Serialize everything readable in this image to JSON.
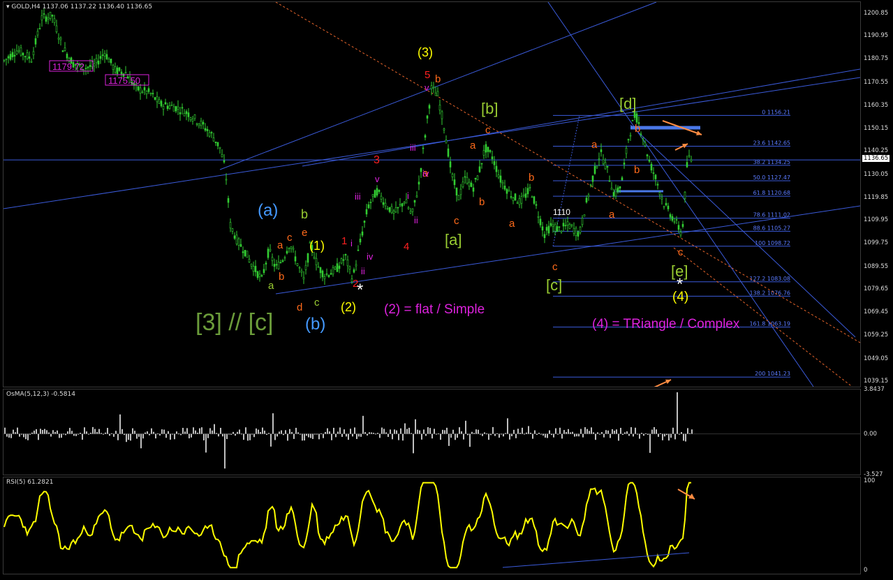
{
  "window": {
    "symbol_title": "GOLD,H4",
    "ohlc": "1137.06 1137.22 1136.40 1136.65",
    "current_price": "1136.65"
  },
  "chart_data": [
    {
      "type": "candlestick",
      "title": "GOLD,H4",
      "ylim": [
        1037,
        1206
      ],
      "y_ticks": [
        "1200.85",
        "1190.95",
        "1180.75",
        "1170.55",
        "1160.35",
        "1150.15",
        "1140.25",
        "1130.05",
        "1119.85",
        "1109.95",
        "1099.75",
        "1089.55",
        "1079.65",
        "1069.45",
        "1059.25",
        "1049.05",
        "1039.15"
      ],
      "price_path": [
        {
          "x": 0,
          "y": 1180
        },
        {
          "x": 20,
          "y": 1185
        },
        {
          "x": 40,
          "y": 1181
        },
        {
          "x": 55,
          "y": 1199
        },
        {
          "x": 70,
          "y": 1200
        },
        {
          "x": 85,
          "y": 1186
        },
        {
          "x": 100,
          "y": 1179
        },
        {
          "x": 115,
          "y": 1177
        },
        {
          "x": 130,
          "y": 1178
        },
        {
          "x": 145,
          "y": 1184
        },
        {
          "x": 160,
          "y": 1176
        },
        {
          "x": 175,
          "y": 1175
        },
        {
          "x": 190,
          "y": 1168
        },
        {
          "x": 210,
          "y": 1166
        },
        {
          "x": 225,
          "y": 1161
        },
        {
          "x": 245,
          "y": 1160
        },
        {
          "x": 265,
          "y": 1157
        },
        {
          "x": 285,
          "y": 1152
        },
        {
          "x": 300,
          "y": 1147
        },
        {
          "x": 310,
          "y": 1142
        },
        {
          "x": 318,
          "y": 1132
        },
        {
          "x": 325,
          "y": 1108
        },
        {
          "x": 335,
          "y": 1101
        },
        {
          "x": 345,
          "y": 1097
        },
        {
          "x": 355,
          "y": 1091
        },
        {
          "x": 370,
          "y": 1084
        },
        {
          "x": 380,
          "y": 1097
        },
        {
          "x": 390,
          "y": 1089
        },
        {
          "x": 400,
          "y": 1093
        },
        {
          "x": 410,
          "y": 1100
        },
        {
          "x": 420,
          "y": 1092
        },
        {
          "x": 430,
          "y": 1084
        },
        {
          "x": 440,
          "y": 1100
        },
        {
          "x": 450,
          "y": 1090
        },
        {
          "x": 460,
          "y": 1086
        },
        {
          "x": 475,
          "y": 1088
        },
        {
          "x": 490,
          "y": 1094
        },
        {
          "x": 500,
          "y": 1084
        },
        {
          "x": 512,
          "y": 1102
        },
        {
          "x": 522,
          "y": 1116
        },
        {
          "x": 535,
          "y": 1123
        },
        {
          "x": 548,
          "y": 1117
        },
        {
          "x": 560,
          "y": 1113
        },
        {
          "x": 575,
          "y": 1119
        },
        {
          "x": 585,
          "y": 1112
        },
        {
          "x": 595,
          "y": 1126
        },
        {
          "x": 605,
          "y": 1150
        },
        {
          "x": 613,
          "y": 1168
        },
        {
          "x": 622,
          "y": 1165
        },
        {
          "x": 632,
          "y": 1150
        },
        {
          "x": 642,
          "y": 1130
        },
        {
          "x": 652,
          "y": 1120
        },
        {
          "x": 662,
          "y": 1129
        },
        {
          "x": 672,
          "y": 1124
        },
        {
          "x": 680,
          "y": 1130
        },
        {
          "x": 690,
          "y": 1142
        },
        {
          "x": 700,
          "y": 1138
        },
        {
          "x": 712,
          "y": 1128
        },
        {
          "x": 725,
          "y": 1122
        },
        {
          "x": 740,
          "y": 1118
        },
        {
          "x": 755,
          "y": 1124
        },
        {
          "x": 765,
          "y": 1114
        },
        {
          "x": 775,
          "y": 1104
        },
        {
          "x": 785,
          "y": 1108
        },
        {
          "x": 795,
          "y": 1106
        },
        {
          "x": 810,
          "y": 1108
        },
        {
          "x": 825,
          "y": 1104
        },
        {
          "x": 835,
          "y": 1118
        },
        {
          "x": 845,
          "y": 1130
        },
        {
          "x": 855,
          "y": 1140
        },
        {
          "x": 865,
          "y": 1132
        },
        {
          "x": 875,
          "y": 1121
        },
        {
          "x": 885,
          "y": 1126
        },
        {
          "x": 895,
          "y": 1146
        },
        {
          "x": 905,
          "y": 1157
        },
        {
          "x": 915,
          "y": 1148
        },
        {
          "x": 925,
          "y": 1136
        },
        {
          "x": 935,
          "y": 1128
        },
        {
          "x": 945,
          "y": 1118
        },
        {
          "x": 955,
          "y": 1113
        },
        {
          "x": 965,
          "y": 1108
        },
        {
          "x": 972,
          "y": 1104
        },
        {
          "x": 980,
          "y": 1138
        },
        {
          "x": 987,
          "y": 1136
        }
      ]
    },
    {
      "type": "bar",
      "title": "OsMA(5,12,3) -0.5814",
      "ylim": [
        -3.527,
        3.8437
      ],
      "y_ticks": [
        "3.8437",
        "0.00",
        "-3.527"
      ]
    },
    {
      "type": "line",
      "title": "RSI(5) 61.2821",
      "ylim": [
        0,
        100
      ],
      "y_ticks": [
        "100",
        "0"
      ]
    }
  ],
  "fib_levels": [
    {
      "label": "0 1156.21",
      "price": 1156.21
    },
    {
      "label": "23.6 1142.65",
      "price": 1142.65
    },
    {
      "label": "38.2 1134.25",
      "price": 1134.25
    },
    {
      "label": "50.0 1127.47",
      "price": 1127.47
    },
    {
      "label": "61.8 1120.68",
      "price": 1120.68
    },
    {
      "label": "78.6 1111.02",
      "price": 1111.02
    },
    {
      "label": "88.6 1105.27",
      "price": 1105.27
    },
    {
      "label": "100 1098.72",
      "price": 1098.72
    },
    {
      "label": "127.2 1083.08",
      "price": 1083.08
    },
    {
      "label": "138.2 1076.76",
      "price": 1076.76
    },
    {
      "label": "161.8 1063.19",
      "price": 1063.19
    },
    {
      "label": "200 1041.23",
      "price": 1041.23
    }
  ],
  "price_boxes": [
    "1179.72",
    "1175.50"
  ],
  "marker_1110": "1110",
  "annotations": [
    {
      "text": "(3)",
      "color": "#ffff00",
      "size": 18
    },
    {
      "text": "5",
      "color": "#ff2020",
      "size": 15
    },
    {
      "text": "b",
      "color": "#ff6a1a",
      "size": 15
    },
    {
      "text": "v",
      "color": "#dd22dd",
      "size": 13
    },
    {
      "text": "iii",
      "color": "#dd22dd",
      "size": 13
    },
    {
      "text": "a",
      "color": "#ff6a1a",
      "size": 15
    },
    {
      "text": "iv",
      "color": "#dd22dd",
      "size": 13
    },
    {
      "text": "3",
      "color": "#ff2020",
      "size": 16
    },
    {
      "text": "v",
      "color": "#dd22dd",
      "size": 13
    },
    {
      "text": "iii",
      "color": "#dd22dd",
      "size": 13
    },
    {
      "text": "i",
      "color": "#dd22dd",
      "size": 13
    },
    {
      "text": "ii",
      "color": "#dd22dd",
      "size": 13
    },
    {
      "text": "4",
      "color": "#ff2020",
      "size": 15
    },
    {
      "text": "1",
      "color": "#ff2020",
      "size": 15
    },
    {
      "text": "i",
      "color": "#dd22dd",
      "size": 13
    },
    {
      "text": "iv",
      "color": "#dd22dd",
      "size": 13
    },
    {
      "text": "ii",
      "color": "#dd22dd",
      "size": 13
    },
    {
      "text": "2",
      "color": "#ff2020",
      "size": 15
    },
    {
      "text": "(2)",
      "color": "#ffff00",
      "size": 18
    },
    {
      "text": "(1)",
      "color": "#ffff00",
      "size": 18
    },
    {
      "text": "(a)",
      "color": "#4499ff",
      "size": 24
    },
    {
      "text": "b",
      "color": "#9acd32",
      "size": 18
    },
    {
      "text": "e",
      "color": "#ff6a1a",
      "size": 15
    },
    {
      "text": "a",
      "color": "#ff6a1a",
      "size": 15
    },
    {
      "text": "c",
      "color": "#ff6a1a",
      "size": 15
    },
    {
      "text": "b",
      "color": "#ff6a1a",
      "size": 15
    },
    {
      "text": "a",
      "color": "#9acd32",
      "size": 15
    },
    {
      "text": "d",
      "color": "#ff6a1a",
      "size": 15
    },
    {
      "text": "c",
      "color": "#9acd32",
      "size": 15
    },
    {
      "text": "(b)",
      "color": "#4499ff",
      "size": 24
    },
    {
      "text": "[3] // [c]",
      "color": "#6b9c3a",
      "size": 34
    },
    {
      "text": "(2) = flat / Simple",
      "color": "#dd22dd",
      "size": 19
    },
    {
      "text": "[b]",
      "color": "#9acd32",
      "size": 22
    },
    {
      "text": "c",
      "color": "#ff6a1a",
      "size": 15
    },
    {
      "text": "a",
      "color": "#ff6a1a",
      "size": 15
    },
    {
      "text": "b",
      "color": "#ff6a1a",
      "size": 15
    },
    {
      "text": "c",
      "color": "#ff6a1a",
      "size": 15
    },
    {
      "text": "[a]",
      "color": "#9acd32",
      "size": 22
    },
    {
      "text": "b",
      "color": "#ff6a1a",
      "size": 15
    },
    {
      "text": "a",
      "color": "#ff6a1a",
      "size": 15
    },
    {
      "text": "c",
      "color": "#ff6a1a",
      "size": 15
    },
    {
      "text": "[c]",
      "color": "#9acd32",
      "size": 22
    },
    {
      "text": "[d]",
      "color": "#9acd32",
      "size": 22
    },
    {
      "text": "a",
      "color": "#ff6a1a",
      "size": 15
    },
    {
      "text": "b",
      "color": "#ff6a1a",
      "size": 15
    },
    {
      "text": "b",
      "color": "#ff6a1a",
      "size": 15
    },
    {
      "text": "a",
      "color": "#ff6a1a",
      "size": 15
    },
    {
      "text": "c",
      "color": "#ff6a1a",
      "size": 15
    },
    {
      "text": "[e]",
      "color": "#9acd32",
      "size": 22
    },
    {
      "text": "(4)",
      "color": "#ffff00",
      "size": 19
    },
    {
      "text": "(4) = TRiangle / Complex",
      "color": "#dd22dd",
      "size": 19
    },
    {
      "text": "*",
      "color": "#ffffff",
      "size": 24
    },
    {
      "text": "*",
      "color": "#ffffff",
      "size": 24
    }
  ],
  "colors": {
    "candle": "#32cd32",
    "rsi": "#ffff00",
    "osma": "#c0c0c0",
    "trend": "#3b5bdb",
    "fib": "#3b5bdb",
    "arrow": "#ff8c42"
  }
}
